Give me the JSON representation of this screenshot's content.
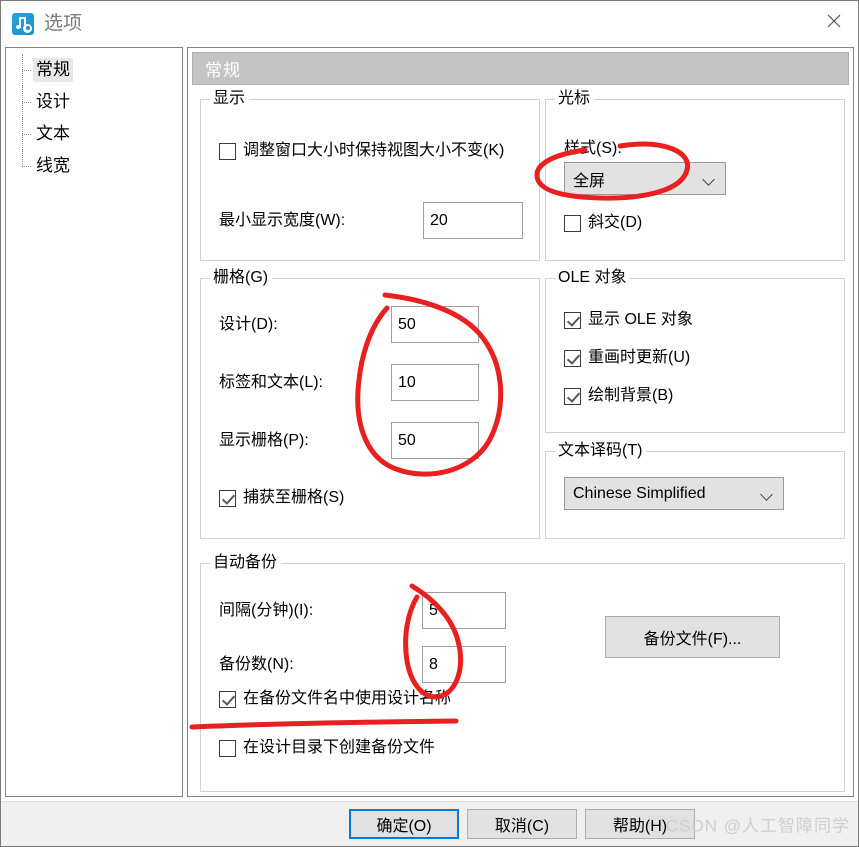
{
  "window": {
    "title": "选项",
    "icon": "music-app-icon",
    "close_label": "×"
  },
  "sidebar": {
    "items": [
      {
        "label": "常规",
        "selected": true
      },
      {
        "label": "设计",
        "selected": false
      },
      {
        "label": "文本",
        "selected": false
      },
      {
        "label": "线宽",
        "selected": false
      }
    ]
  },
  "panel": {
    "header": "常规",
    "groups": {
      "display": {
        "legend": "显示",
        "keep_view_size_checkbox": "调整窗口大小时保持视图大小不变(K)",
        "keep_view_size_checked": false,
        "min_width_label": "最小显示宽度(W):",
        "min_width_value": "20"
      },
      "cursor": {
        "legend": "光标",
        "style_label": "样式(S):",
        "style_value": "全屏",
        "oblique_checkbox": "斜交(D)",
        "oblique_checked": false
      },
      "grid": {
        "legend": "栅格(G)",
        "design_label": "设计(D):",
        "design_value": "50",
        "label_text_label": "标签和文本(L):",
        "label_text_value": "10",
        "show_grid_label": "显示栅格(P):",
        "show_grid_value": "50",
        "snap_checkbox": "捕获至栅格(S)",
        "snap_checked": true
      },
      "ole": {
        "legend": "OLE 对象",
        "show_ole_checkbox": "显示 OLE 对象",
        "show_ole_checked": true,
        "update_redraw_checkbox": "重画时更新(U)",
        "update_redraw_checked": true,
        "draw_background_checkbox": "绘制背景(B)",
        "draw_background_checked": true
      },
      "textcode": {
        "legend": "文本译码(T)",
        "encoding_value": "Chinese Simplified"
      },
      "backup": {
        "legend": "自动备份",
        "interval_label": "间隔(分钟)(I):",
        "interval_value": "5",
        "count_label": "备份数(N):",
        "count_value": "8",
        "use_design_name_checkbox": "在备份文件名中使用设计名称",
        "use_design_name_checked": true,
        "create_in_design_dir_checkbox": "在设计目录下创建备份文件",
        "create_in_design_dir_checked": false,
        "backup_files_button": "备份文件(F)..."
      }
    }
  },
  "footer": {
    "ok": "确定(O)",
    "cancel": "取消(C)",
    "help": "帮助(H)",
    "watermark": "CSDN @人工智障同学"
  },
  "annotations": {
    "color": "#e8201f",
    "marks": [
      "ellipse-around-cursor-style-combo",
      "ellipse-around-grid-value-fields",
      "ellipse-around-backup-value-fields",
      "underline-under-use-design-name-checkbox"
    ]
  }
}
